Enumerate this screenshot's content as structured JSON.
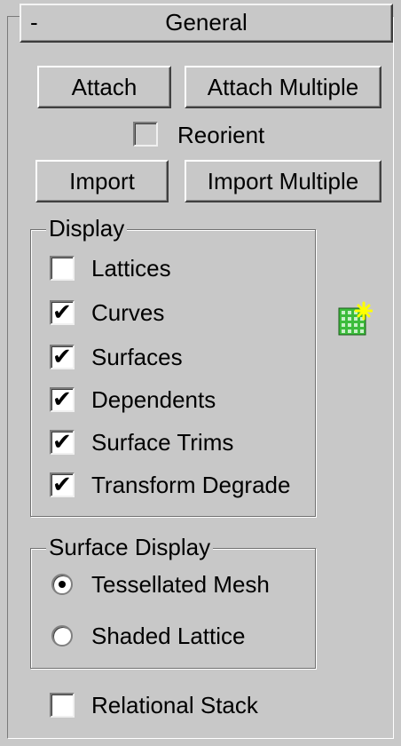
{
  "rollout": {
    "toggle": "-",
    "title": "General"
  },
  "buttons": {
    "attach": "Attach",
    "attach_multiple": "Attach Multiple",
    "import": "Import",
    "import_multiple": "Import Multiple"
  },
  "reorient": {
    "label": "Reorient",
    "checked": false
  },
  "display": {
    "title": "Display",
    "items": [
      {
        "label": "Lattices",
        "checked": false
      },
      {
        "label": "Curves",
        "checked": true
      },
      {
        "label": "Surfaces",
        "checked": true
      },
      {
        "label": "Dependents",
        "checked": true
      },
      {
        "label": "Surface Trims",
        "checked": true
      },
      {
        "label": "Transform Degrade",
        "checked": true
      }
    ]
  },
  "surface_display": {
    "title": "Surface Display",
    "options": [
      {
        "label": "Tessellated Mesh",
        "selected": true
      },
      {
        "label": "Shaded Lattice",
        "selected": false
      }
    ]
  },
  "relational_stack": {
    "label": "Relational Stack",
    "checked": false
  },
  "check_glyph": "✔",
  "icons": {
    "selection": "surface-selection-icon"
  },
  "colors": {
    "panel_bg": "#c8c8c8",
    "icon_green": "#3cbc3c",
    "icon_star": "#ffff00"
  }
}
